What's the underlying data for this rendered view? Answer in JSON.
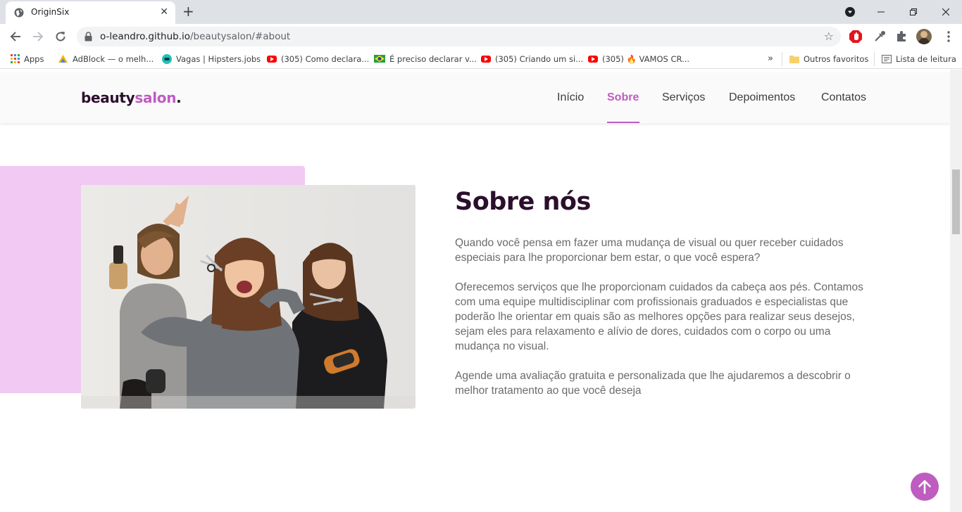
{
  "browser": {
    "tab_title": "OriginSix",
    "url_host": "o-leandro.github.io",
    "url_path": "/beautysalon/#about",
    "bookmarks": [
      {
        "label": "Apps",
        "icon": "apps-grid-icon"
      },
      {
        "label": "AdBlock — o melh...",
        "icon": "adblock-icon"
      },
      {
        "label": "Vagas | Hipsters.jobs",
        "icon": "hipsters-icon"
      },
      {
        "label": "(305) Como declara...",
        "icon": "youtube-icon"
      },
      {
        "label": "É preciso declarar v...",
        "icon": "brazil-flag-icon"
      },
      {
        "label": "(305) Criando um si...",
        "icon": "youtube-icon"
      },
      {
        "label": "(305) 🔥 VAMOS CR...",
        "icon": "youtube-icon"
      }
    ],
    "more_bookmarks": "»",
    "other_favorites": "Outros favoritos",
    "reading_list": "Lista de leitura"
  },
  "site": {
    "logo_main": "beauty",
    "logo_accent": "salon",
    "logo_dot": ".",
    "nav": [
      {
        "label": "Início",
        "active": false
      },
      {
        "label": "Sobre",
        "active": true
      },
      {
        "label": "Serviços",
        "active": false
      },
      {
        "label": "Depoimentos",
        "active": false
      },
      {
        "label": "Contatos",
        "active": false
      }
    ]
  },
  "about": {
    "title": "Sobre nós",
    "paragraphs": [
      "Quando você pensa em fazer uma mudança de visual ou quer receber cuidados especiais para lhe proporcionar bem estar, o que você espera?",
      "Oferecemos serviços que lhe proporcionam cuidados da cabeça aos pés. Contamos com uma equipe multidisciplinar com profissionais graduados e especialistas que poderão lhe orientar em quais são as melhores opções para realizar seus desejos, sejam eles para relaxamento e alívio de dores, cuidados com o corpo ou uma mudança no visual.",
      "Agende uma avaliação gratuita e personalizada que lhe ajudaremos a descobrir o melhor tratamento ao que você deseja"
    ]
  },
  "colors": {
    "accent": "#bf5cc0",
    "title": "#2b0f2c",
    "pink_block": "#f2c9f2"
  }
}
